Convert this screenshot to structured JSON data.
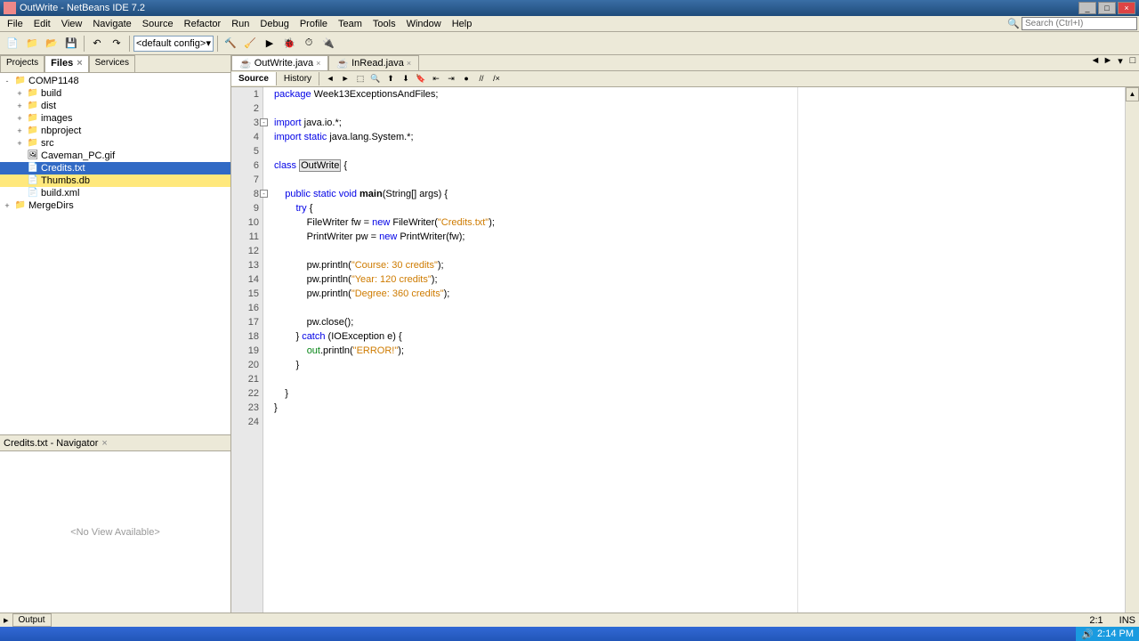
{
  "title": "OutWrite - NetBeans IDE 7.2",
  "menu": [
    "File",
    "Edit",
    "View",
    "Navigate",
    "Source",
    "Refactor",
    "Run",
    "Debug",
    "Profile",
    "Team",
    "Tools",
    "Window",
    "Help"
  ],
  "search_placeholder": "Search (Ctrl+I)",
  "config_combo": "<default config>",
  "left_tabs": {
    "projects": "Projects",
    "files": "Files",
    "services": "Services"
  },
  "tree": [
    {
      "d": 0,
      "exp": "-",
      "ico": "📁",
      "lbl": "COMP1148"
    },
    {
      "d": 1,
      "exp": "+",
      "ico": "📁",
      "lbl": "build"
    },
    {
      "d": 1,
      "exp": "+",
      "ico": "📁",
      "lbl": "dist"
    },
    {
      "d": 1,
      "exp": "+",
      "ico": "📁",
      "lbl": "images"
    },
    {
      "d": 1,
      "exp": "+",
      "ico": "📁",
      "lbl": "nbproject"
    },
    {
      "d": 1,
      "exp": "+",
      "ico": "📁",
      "lbl": "src"
    },
    {
      "d": 1,
      "exp": "",
      "ico": "🖼",
      "lbl": "Caveman_PC.gif"
    },
    {
      "d": 1,
      "exp": "",
      "ico": "📄",
      "lbl": "Credits.txt",
      "sel": true
    },
    {
      "d": 1,
      "exp": "",
      "ico": "📄",
      "lbl": "Thumbs.db",
      "hl": true
    },
    {
      "d": 1,
      "exp": "",
      "ico": "📄",
      "lbl": "build.xml"
    },
    {
      "d": 0,
      "exp": "+",
      "ico": "📁",
      "lbl": "MergeDirs"
    }
  ],
  "nav_title": "Credits.txt - Navigator",
  "nav_msg": "<No View Available>",
  "editor_tabs": [
    {
      "lbl": "OutWrite.java",
      "active": true
    },
    {
      "lbl": "InRead.java",
      "active": false
    }
  ],
  "src_tabs": {
    "source": "Source",
    "history": "History"
  },
  "code": {
    "lines": [
      {
        "n": 1,
        "tokens": [
          {
            "t": "package ",
            "c": "kw"
          },
          {
            "t": "Week13ExceptionsAndFiles;"
          }
        ]
      },
      {
        "n": 2,
        "tokens": []
      },
      {
        "n": 3,
        "fold": "-",
        "tokens": [
          {
            "t": "import ",
            "c": "kw"
          },
          {
            "t": "java.io.*;"
          }
        ]
      },
      {
        "n": 4,
        "tokens": [
          {
            "t": "import static ",
            "c": "kw"
          },
          {
            "t": "java.lang.System.*;"
          }
        ]
      },
      {
        "n": 5,
        "tokens": []
      },
      {
        "n": 6,
        "tokens": [
          {
            "t": "class ",
            "c": "kw"
          },
          {
            "t": "OutWrite",
            "c": "hl-box"
          },
          {
            "t": " {"
          }
        ]
      },
      {
        "n": 7,
        "tokens": []
      },
      {
        "n": 8,
        "fold": "-",
        "tokens": [
          {
            "t": "    "
          },
          {
            "t": "public static void ",
            "c": "kw"
          },
          {
            "t": "main",
            "c": "mth"
          },
          {
            "t": "(String[] args) {"
          }
        ]
      },
      {
        "n": 9,
        "tokens": [
          {
            "t": "        "
          },
          {
            "t": "try ",
            "c": "kw"
          },
          {
            "t": "{"
          }
        ]
      },
      {
        "n": 10,
        "tokens": [
          {
            "t": "            FileWriter fw = "
          },
          {
            "t": "new ",
            "c": "kw"
          },
          {
            "t": "FileWriter("
          },
          {
            "t": "\"Credits.txt\"",
            "c": "str"
          },
          {
            "t": ");"
          }
        ]
      },
      {
        "n": 11,
        "tokens": [
          {
            "t": "            PrintWriter pw = "
          },
          {
            "t": "new ",
            "c": "kw"
          },
          {
            "t": "PrintWriter(fw);"
          }
        ]
      },
      {
        "n": 12,
        "tokens": []
      },
      {
        "n": 13,
        "tokens": [
          {
            "t": "            pw.println("
          },
          {
            "t": "\"Course: 30 credits\"",
            "c": "str"
          },
          {
            "t": ");"
          }
        ]
      },
      {
        "n": 14,
        "tokens": [
          {
            "t": "            pw.println("
          },
          {
            "t": "\"Year: 120 credits\"",
            "c": "str"
          },
          {
            "t": ");"
          }
        ]
      },
      {
        "n": 15,
        "tokens": [
          {
            "t": "            pw.println("
          },
          {
            "t": "\"Degree: 360 credits\"",
            "c": "str"
          },
          {
            "t": ");"
          }
        ]
      },
      {
        "n": 16,
        "tokens": []
      },
      {
        "n": 17,
        "tokens": [
          {
            "t": "            pw.close();"
          }
        ]
      },
      {
        "n": 18,
        "tokens": [
          {
            "t": "        } "
          },
          {
            "t": "catch ",
            "c": "kw"
          },
          {
            "t": "(IOException e) {"
          }
        ]
      },
      {
        "n": 19,
        "tokens": [
          {
            "t": "            "
          },
          {
            "t": "out",
            "c": "fld"
          },
          {
            "t": ".println("
          },
          {
            "t": "\"ERROR!\"",
            "c": "str"
          },
          {
            "t": ");"
          }
        ]
      },
      {
        "n": 20,
        "tokens": [
          {
            "t": "        }"
          }
        ]
      },
      {
        "n": 21,
        "tokens": []
      },
      {
        "n": 22,
        "tokens": [
          {
            "t": "    }"
          }
        ]
      },
      {
        "n": 23,
        "tokens": [
          {
            "t": "}"
          }
        ]
      },
      {
        "n": 24,
        "tokens": []
      }
    ]
  },
  "output_btn": "Output",
  "status": {
    "pos": "2:1",
    "ins": "INS"
  },
  "clock": "2:14 PM"
}
